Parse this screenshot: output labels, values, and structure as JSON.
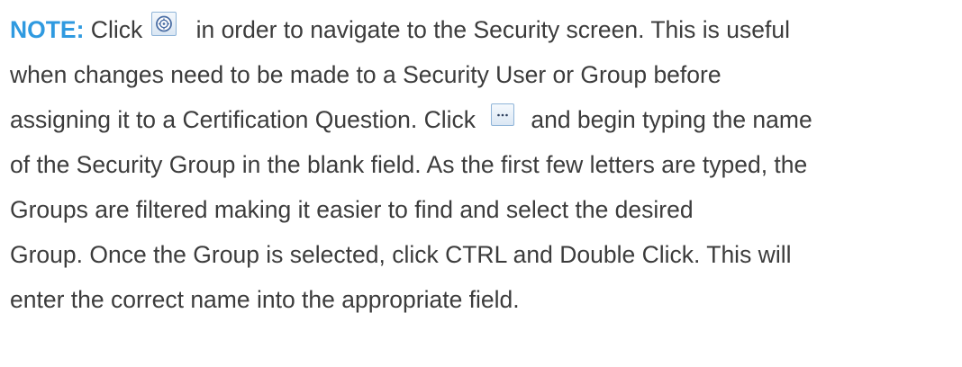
{
  "note": {
    "label": "NOTE:",
    "line1_before": " Click ",
    "line1_after": "in order to navigate to the Security screen. This is useful",
    "line2": "when changes need to be made to a Security User or Group before",
    "line3_before": "assigning it to a Certification Question. Click ",
    "line3_after": "and begin typing the name",
    "line4": "of the Security Group in the blank field. As the first few letters are typed, the",
    "line5": "Groups are filtered making it easier to find and select the desired",
    "line6": "Group. Once the Group is selected, click CTRL and Double Click. This will",
    "line7": "enter the correct name into the appropriate field."
  },
  "icons": {
    "navigate": "security-navigate-icon",
    "ellipsis": "ellipsis-button-icon"
  },
  "colors": {
    "note_label": "#2f9ae0",
    "body_text": "#3c3c3c"
  }
}
